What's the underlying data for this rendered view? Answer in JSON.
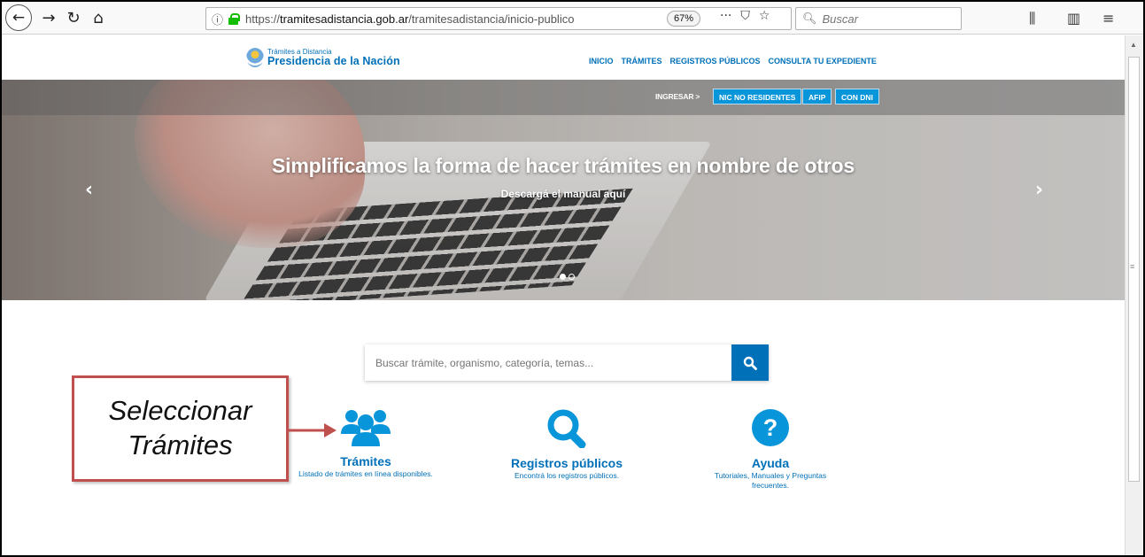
{
  "browser": {
    "back_icon": "arrow-left-icon",
    "forward_icon": "arrow-right-icon",
    "reload_icon": "reload-icon",
    "home_icon": "home-icon",
    "url_scheme": "https://",
    "url_host": "tramitesadistancia.gob.ar",
    "url_path": "/tramitesadistancia/inicio-publico",
    "zoom": "67%",
    "search_placeholder": "Buscar"
  },
  "site": {
    "logo_small": "Trámites a Distancia",
    "logo_big": "Presidencia de la Nación",
    "nav": [
      "INICIO",
      "TRÁMITES",
      "REGISTROS PÚBLICOS",
      "CONSULTA TU EXPEDIENTE"
    ]
  },
  "hero": {
    "ingresar": "INGRESAR >",
    "login_buttons": [
      "NIC NO RESIDENTES",
      "AFIP",
      "CON DNI"
    ],
    "title": "Simplificamos la forma de hacer trámites en nombre de otros",
    "subtitle": "Descargá el manual aquí",
    "active_slide": 1,
    "slide_count": 2
  },
  "search": {
    "placeholder": "Buscar trámite, organismo, categoría, temas..."
  },
  "features": [
    {
      "icon": "users-icon",
      "title": "Trámites",
      "desc": "Listado de trámites en línea disponibles."
    },
    {
      "icon": "search-icon",
      "title": "Registros públicos",
      "desc": "Encontrá los registros públicos."
    },
    {
      "icon": "help-icon",
      "title": "Ayuda",
      "desc_line1": "Tutoriales, Manuales y Preguntas",
      "desc_line2": "frecuentes."
    }
  ],
  "annotation": {
    "line1": "Seleccionar",
    "line2": "Trámites"
  },
  "colors": {
    "brand_blue": "#0070b8",
    "login_blue": "#0895d9",
    "annotation_red": "#c0504d"
  }
}
